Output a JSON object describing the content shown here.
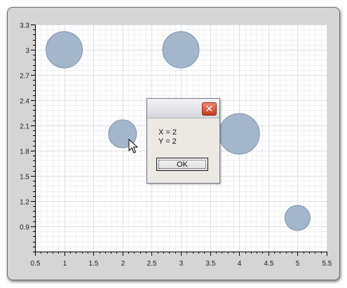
{
  "chart_data": {
    "type": "scatter",
    "title": "",
    "xlabel": "",
    "ylabel": "",
    "xlim": [
      0.5,
      5.5
    ],
    "ylim": [
      0.6,
      3.3
    ],
    "x_ticks": [
      "0.5",
      "1",
      "1.5",
      "2",
      "2.5",
      "3",
      "3.5",
      "4",
      "4.5",
      "5",
      "5.5"
    ],
    "y_ticks": [
      "0.9",
      "1.2",
      "1.5",
      "1.8",
      "2.1",
      "2.4",
      "2.7",
      "3",
      "3.3"
    ],
    "grid": true,
    "points": [
      {
        "x": 1,
        "y": 3,
        "size": 1.3
      },
      {
        "x": 3,
        "y": 3,
        "size": 1.3
      },
      {
        "x": 2,
        "y": 2,
        "size": 1.0
      },
      {
        "x": 4,
        "y": 2,
        "size": 1.45
      },
      {
        "x": 5,
        "y": 1,
        "size": 0.9
      }
    ],
    "marker_color": "#a4b6cc",
    "marker_edge_color": "#7f93ad"
  },
  "message_box": {
    "close_glyph": "✕",
    "line_x": "X = 2",
    "line_y": "Y = 2",
    "ok_label": "OK"
  },
  "colors": {
    "frame": "#d5d5d5",
    "plot_background": "#ffffff",
    "major_grid": "#dcdfe4",
    "minor_grid": "#eef0f3"
  }
}
